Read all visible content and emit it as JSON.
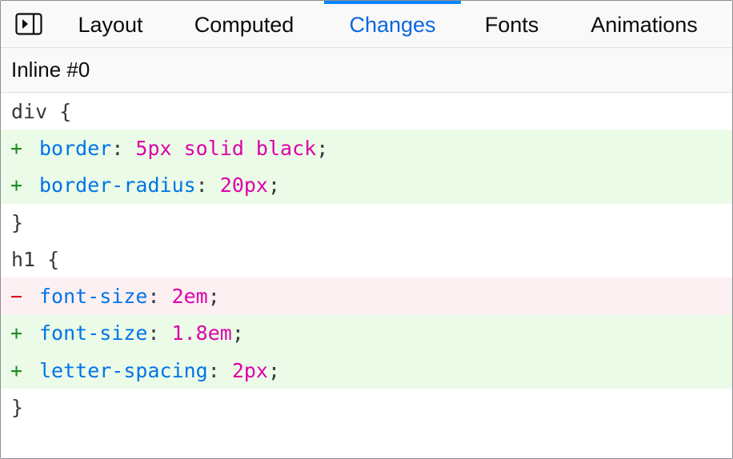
{
  "sidebar_toggle": {
    "icon": "sidebar-toggle-icon"
  },
  "tabs": [
    {
      "label": "Layout",
      "active": false
    },
    {
      "label": "Computed",
      "active": false
    },
    {
      "label": "Changes",
      "active": true
    },
    {
      "label": "Fonts",
      "active": false
    },
    {
      "label": "Animations",
      "active": false
    }
  ],
  "source": {
    "label": "Inline #0"
  },
  "rules": [
    {
      "selector": "div {",
      "declarations": [
        {
          "type": "added",
          "marker": "+",
          "property": "border",
          "value": "5px solid black"
        },
        {
          "type": "added",
          "marker": "+",
          "property": "border-radius",
          "value": "20px"
        }
      ],
      "close": "}"
    },
    {
      "selector": "h1 {",
      "declarations": [
        {
          "type": "removed",
          "marker": "−",
          "property": "font-size",
          "value": "2em"
        },
        {
          "type": "added",
          "marker": "+",
          "property": "font-size",
          "value": "1.8em"
        },
        {
          "type": "added",
          "marker": "+",
          "property": "letter-spacing",
          "value": "2px"
        }
      ],
      "close": "}"
    }
  ],
  "colors": {
    "accent": "#0a84ff",
    "active_tab_text": "#0a67dd",
    "added_bg": "#ebfbe7",
    "removed_bg": "#fcf0f3",
    "added_marker": "#1c8a1c",
    "removed_marker": "#d70022",
    "property": "#0074e8",
    "value": "#dd00a9"
  }
}
